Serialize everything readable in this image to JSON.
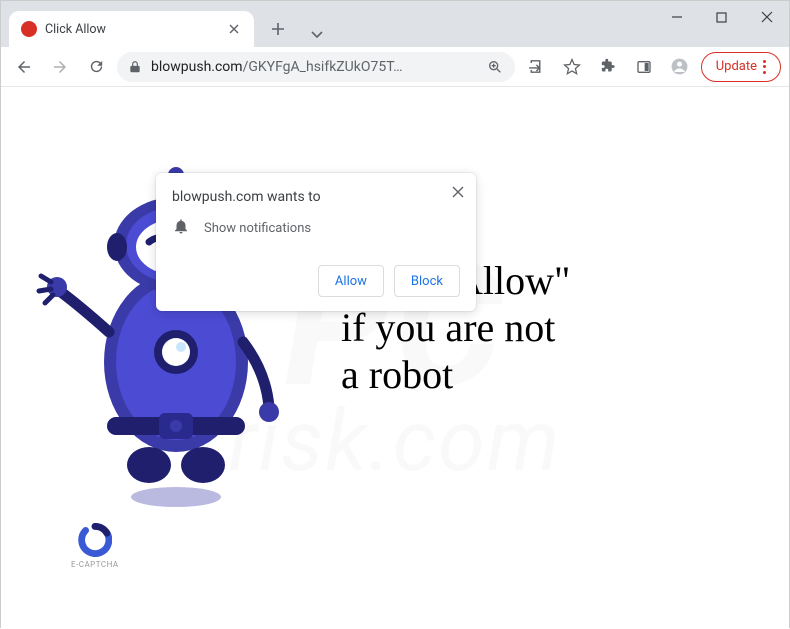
{
  "browser": {
    "tab_title": "Click Allow",
    "update_label": "Update"
  },
  "address": {
    "domain": "blowpush.com",
    "path": "/GKYFgA_hsifkZUkO75T…"
  },
  "permission": {
    "title": "blowpush.com wants to",
    "capability": "Show notifications",
    "allow": "Allow",
    "block": "Block"
  },
  "page": {
    "headline_line1": "Click \"Allow\"",
    "headline_line2": "if you are not",
    "headline_line3": "a robot",
    "captcha_label": "E-CAPTCHA"
  },
  "watermark": {
    "line1": "PC",
    "line2": "risk.com"
  }
}
